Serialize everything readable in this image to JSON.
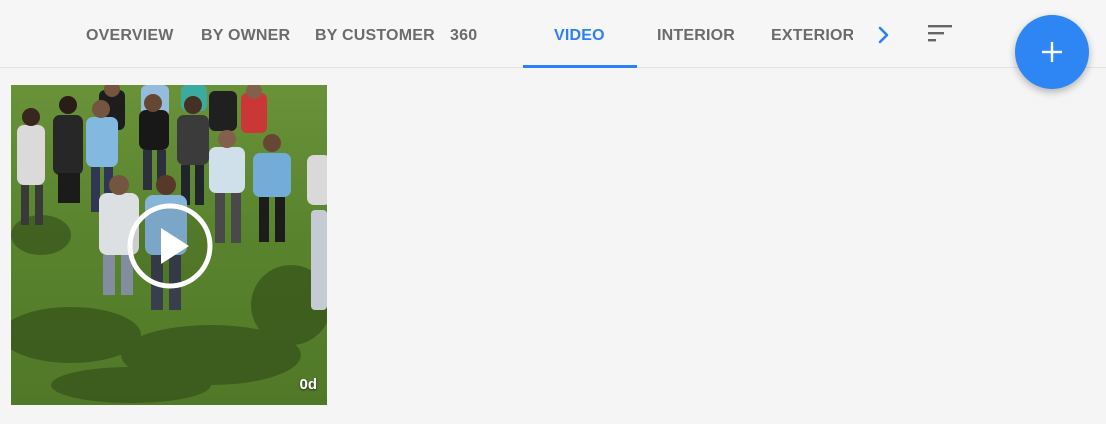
{
  "tabs": [
    {
      "label": "OVERVIEW",
      "active": false
    },
    {
      "label": "BY OWNER",
      "active": false
    },
    {
      "label": "BY CUSTOMER",
      "active": false
    },
    {
      "label": "360",
      "active": false
    },
    {
      "label": "VIDEO",
      "active": true
    },
    {
      "label": "INTERIOR",
      "active": false
    },
    {
      "label": "EXTERIOR",
      "active": false
    }
  ],
  "icons": {
    "next": "chevron-right-icon",
    "sort": "sort-icon",
    "add": "plus-icon",
    "play": "play-icon"
  },
  "colors": {
    "accent": "#2d7ff9",
    "fab": "#2e86f4",
    "tab_text": "#6b6b6b"
  },
  "media": [
    {
      "type": "video",
      "duration": "0d"
    }
  ]
}
